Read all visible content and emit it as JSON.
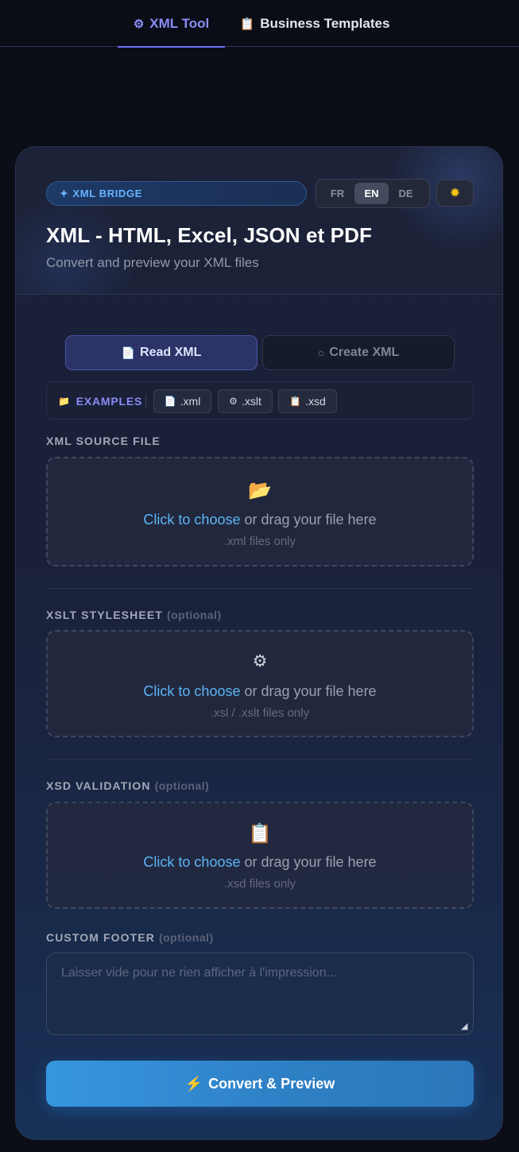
{
  "nav": {
    "tabs": [
      {
        "icon": "⚙",
        "label": "XML Tool",
        "active": true
      },
      {
        "icon": "📋",
        "label": "Business Templates",
        "active": false
      }
    ]
  },
  "header": {
    "badge": "XML BRIDGE",
    "badge_icon": "✦",
    "languages": [
      "FR",
      "EN",
      "DE"
    ],
    "active_language": "EN",
    "theme_icon": "✹",
    "title": "XML - HTML, Excel, JSON et PDF",
    "subtitle": "Convert and preview your XML files"
  },
  "modes": {
    "read": {
      "icon": "📄",
      "label": "Read XML",
      "active": true
    },
    "create": {
      "icon": "○",
      "label": "Create XML",
      "active": false
    }
  },
  "examples": {
    "label": "EXAMPLES",
    "icon": "📁",
    "chips": [
      {
        "icon": "📄",
        "label": ".xml"
      },
      {
        "icon": "⚙",
        "label": ".xslt"
      },
      {
        "icon": "📋",
        "label": ".xsd"
      }
    ]
  },
  "sections": {
    "xml": {
      "label": "XML SOURCE FILE",
      "optional": "",
      "icon": "📂",
      "link": "Click to choose",
      "rest": " or drag your file here",
      "hint": ".xml files only"
    },
    "xslt": {
      "label": "XSLT STYLESHEET",
      "optional": "(optional)",
      "icon": "⚙",
      "link": "Click to choose",
      "rest": " or drag your file here",
      "hint": ".xsl / .xslt files only"
    },
    "xsd": {
      "label": "XSD VALIDATION",
      "optional": "(optional)",
      "icon": "📋",
      "link": "Click to choose",
      "rest": " or drag your file here",
      "hint": ".xsd files only"
    },
    "footer": {
      "label": "CUSTOM FOOTER",
      "optional": "(optional)",
      "placeholder": "Laisser vide pour ne rien afficher à l'impression...",
      "value": ""
    }
  },
  "convert": {
    "icon": "⚡",
    "label": "Convert & Preview"
  },
  "colors": {
    "accent": "#8b8cf6",
    "link": "#5cb5f5",
    "badge_text": "#66b3ff",
    "button": "#3796df"
  }
}
